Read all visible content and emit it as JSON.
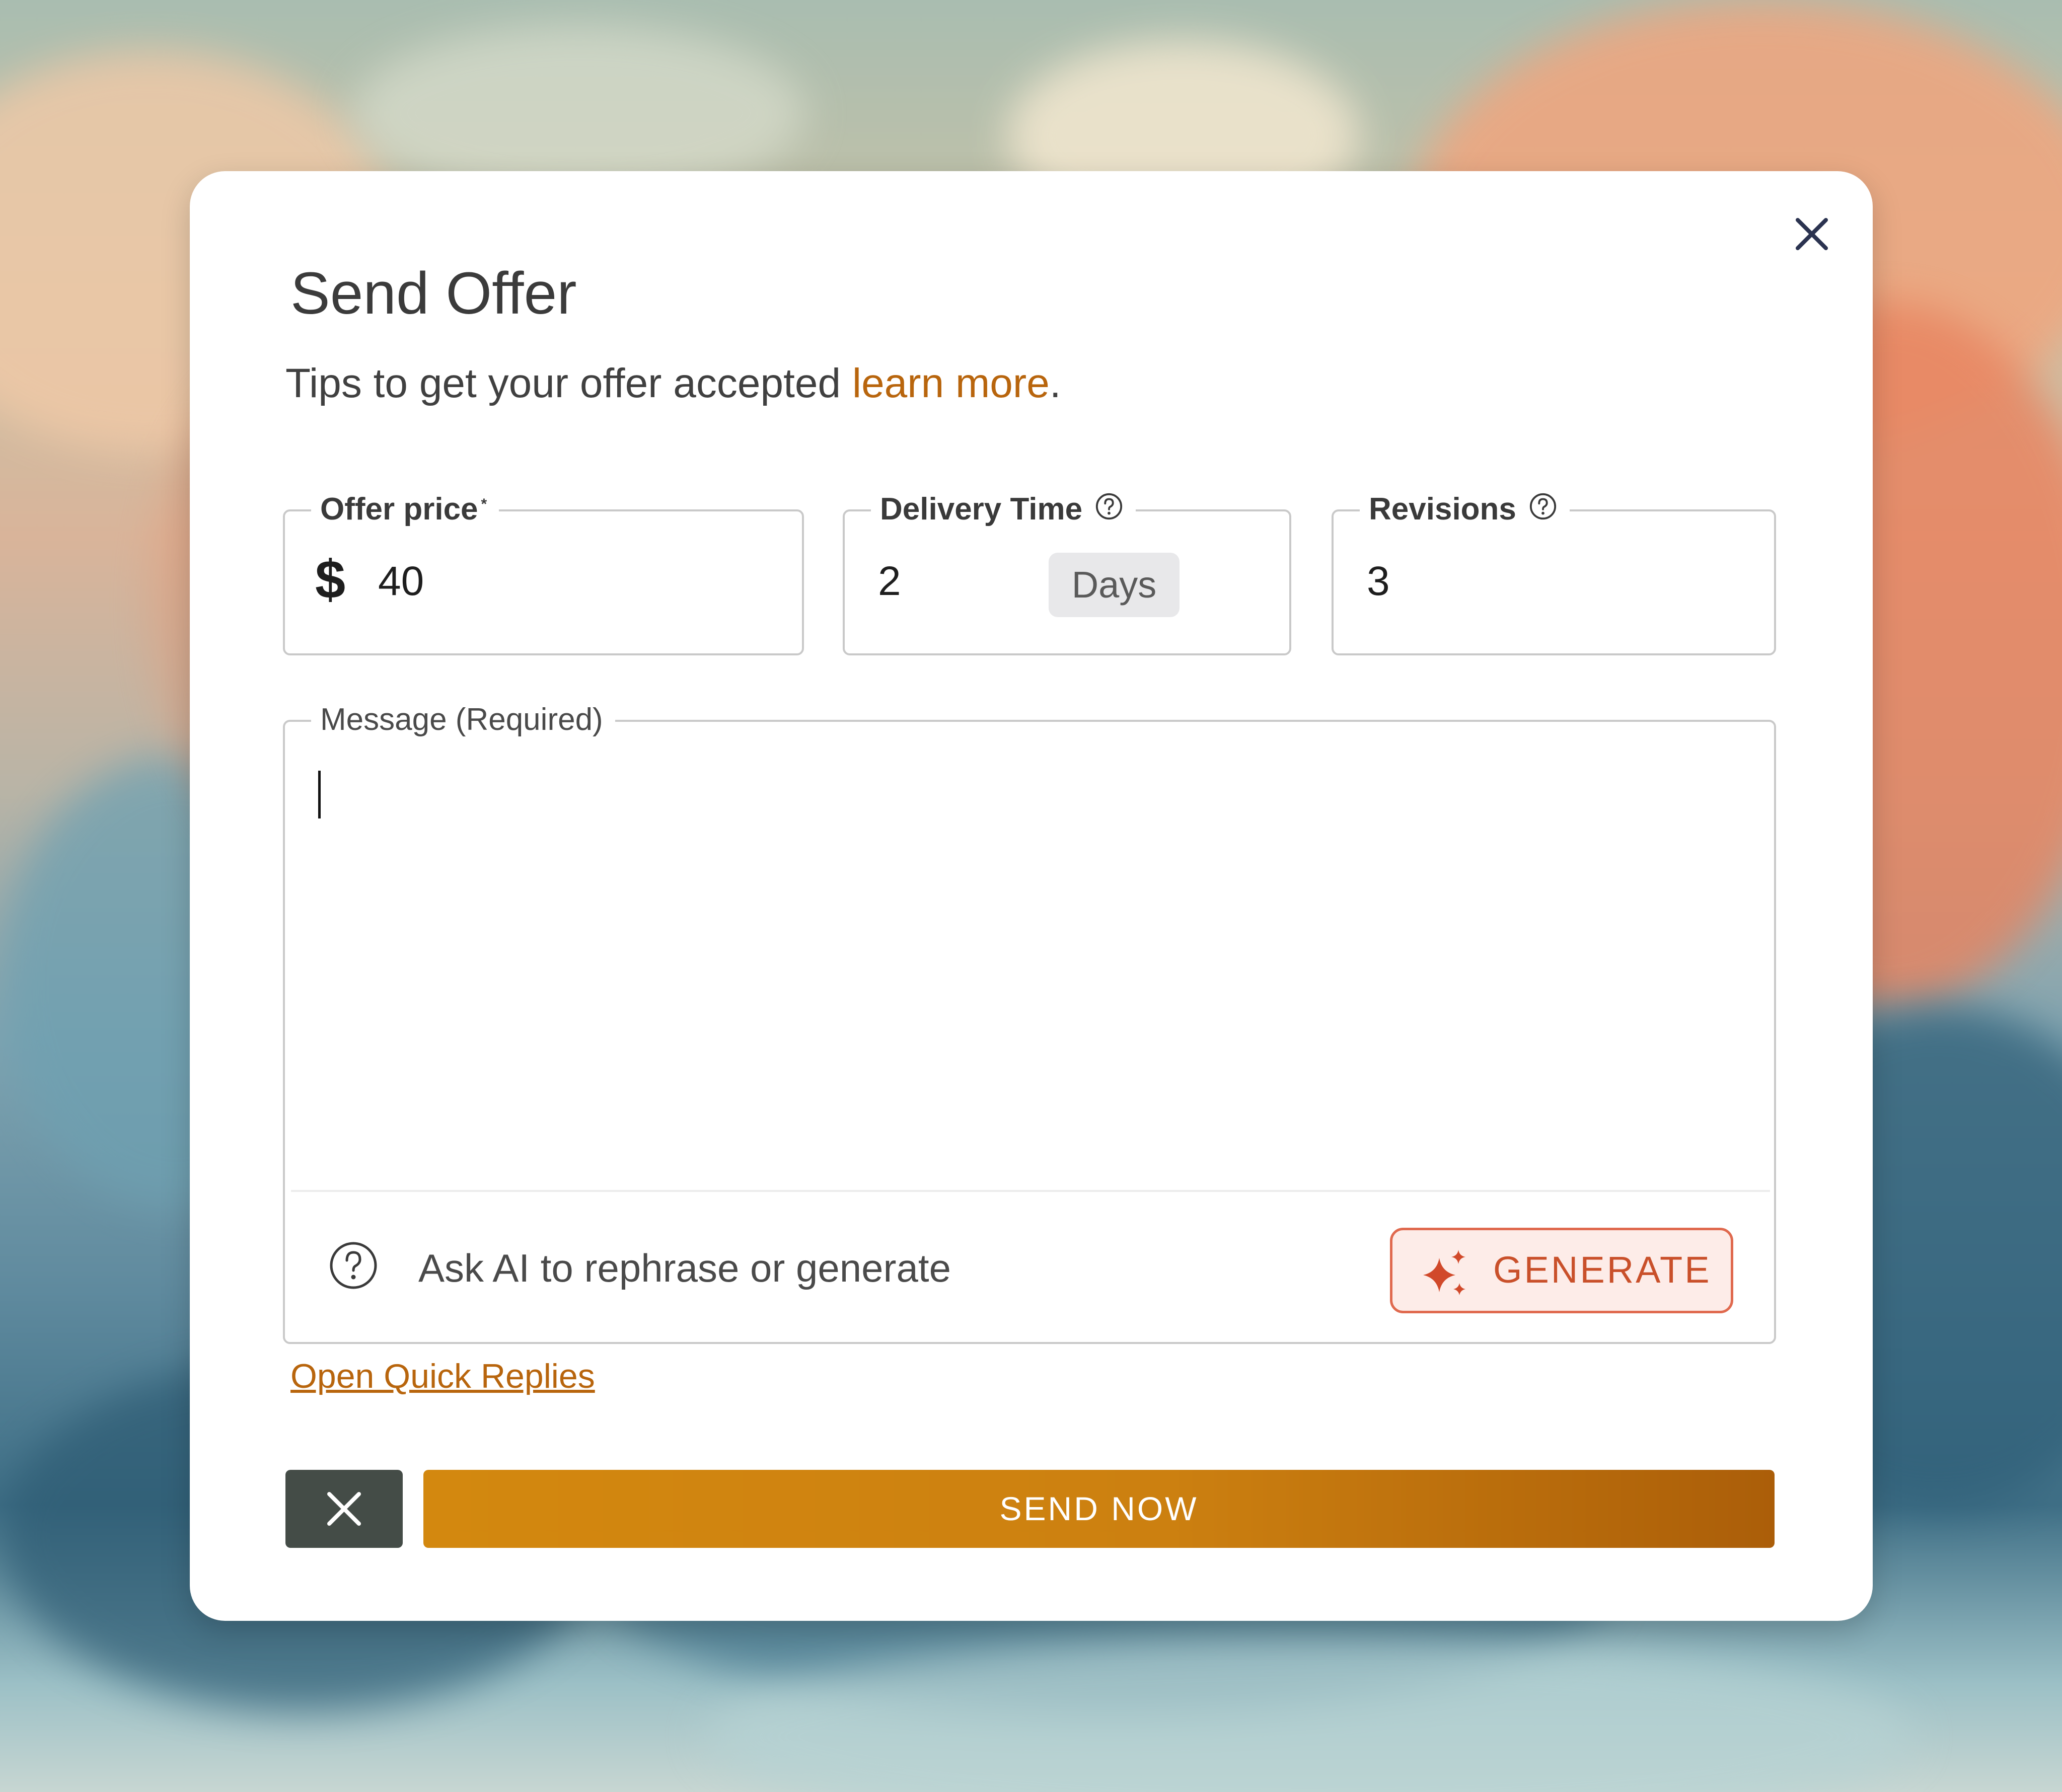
{
  "dialog": {
    "title": "Send Offer",
    "subtitle_prefix": "Tips to get your offer accepted ",
    "learn_more_link": "learn more",
    "subtitle_suffix": "."
  },
  "fields": {
    "offer_price": {
      "label": "Offer price",
      "required_mark": "*",
      "currency_symbol": "$",
      "value": "40"
    },
    "delivery_time": {
      "label": "Delivery Time",
      "value": "2",
      "unit": "Days"
    },
    "revisions": {
      "label": "Revisions",
      "value": "3"
    }
  },
  "message": {
    "label": "Message (Required)",
    "value": "",
    "ai_prompt": "Ask AI to rephrase or generate",
    "generate_label": "GENERATE"
  },
  "links": {
    "quick_replies": "Open Quick Replies"
  },
  "actions": {
    "send_label": "SEND NOW"
  },
  "icons": {
    "close": "close-icon",
    "help": "question-circle-icon",
    "sparkle": "sparkle-icon",
    "cancel": "close-icon"
  },
  "colors": {
    "accent": "#b8650d",
    "send_gradient_start": "#d3880f",
    "send_gradient_end": "#ab5e09",
    "generate_border": "#e06a4f",
    "generate_text": "#c9502a",
    "cancel_bg": "#444c47"
  }
}
